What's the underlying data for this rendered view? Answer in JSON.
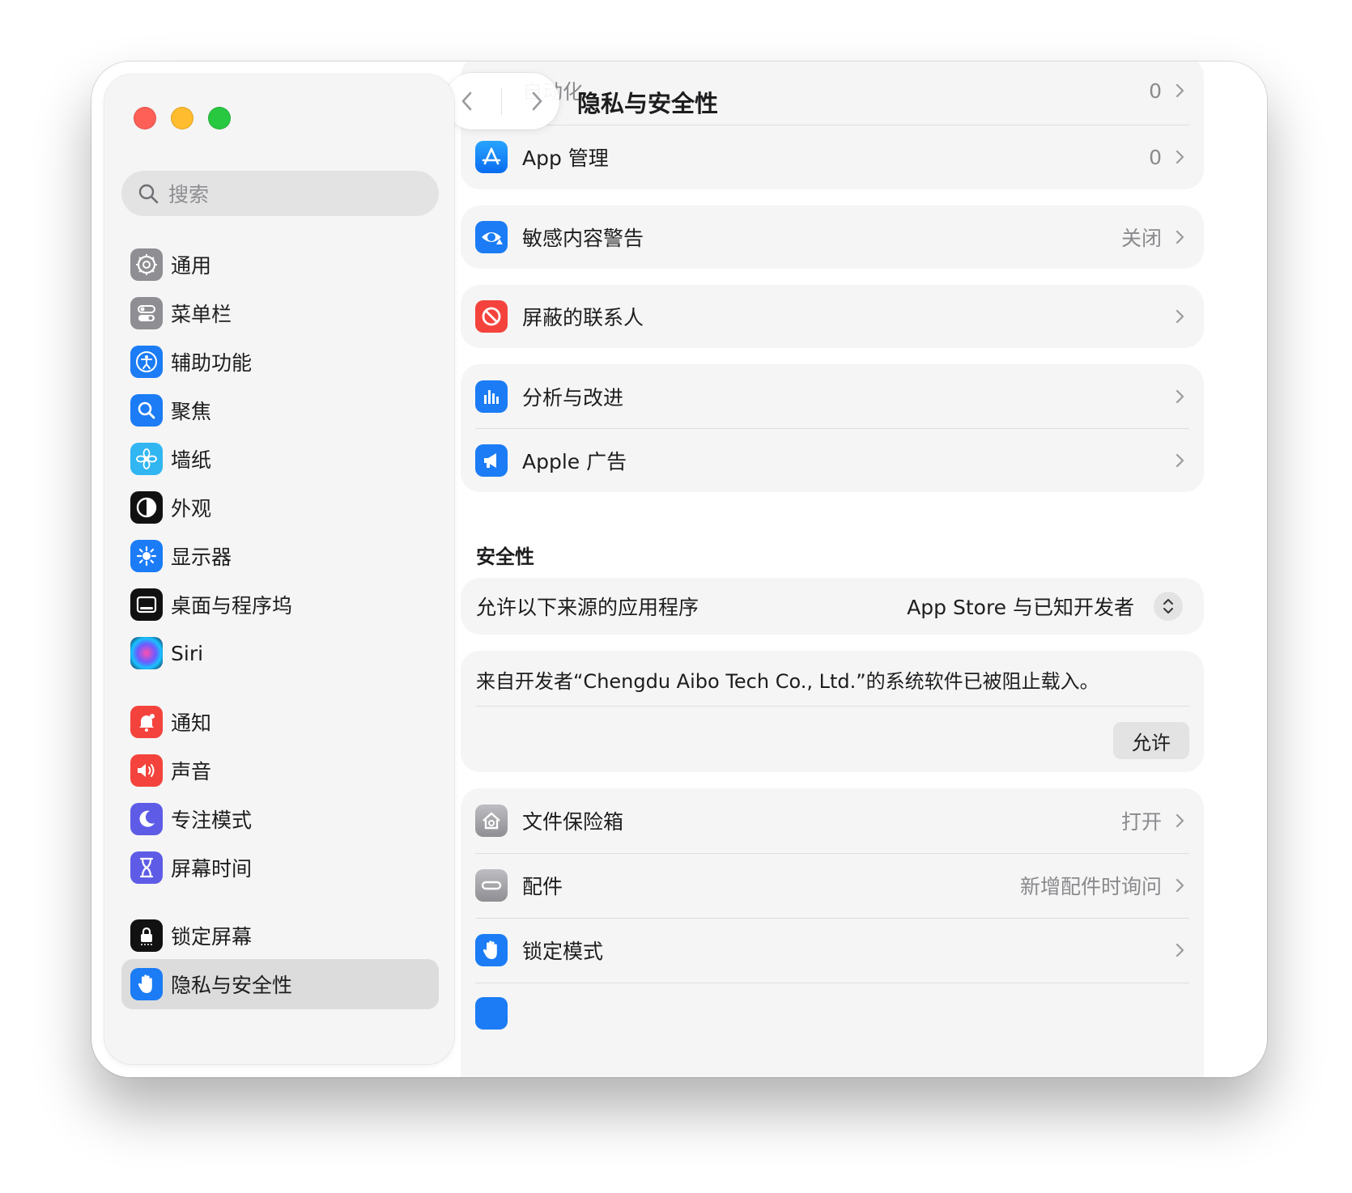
{
  "window": {
    "title": "隐私与安全性",
    "search_placeholder": "搜索"
  },
  "sidebar": {
    "items": [
      {
        "label": "通用",
        "icon": "gear-icon",
        "color": "#8e8e93"
      },
      {
        "label": "菜单栏",
        "icon": "toggles-icon",
        "color": "#8e8e93"
      },
      {
        "label": "辅助功能",
        "icon": "accessibility-icon",
        "color": "#1b7cf5"
      },
      {
        "label": "聚焦",
        "icon": "magnifier-icon",
        "color": "#1b7cf5"
      },
      {
        "label": "墙纸",
        "icon": "flower-icon",
        "color": "#31b6f2"
      },
      {
        "label": "外观",
        "icon": "appearance-icon",
        "color": "#111111"
      },
      {
        "label": "显示器",
        "icon": "sun-icon",
        "color": "#1b7cf5"
      },
      {
        "label": "桌面与程序坞",
        "icon": "dock-icon",
        "color": "#111111"
      },
      {
        "label": "Siri",
        "icon": "siri-icon",
        "color": "#2b2b6e"
      },
      {
        "label": "通知",
        "icon": "bell-icon",
        "color": "#f4433c"
      },
      {
        "label": "声音",
        "icon": "speaker-icon",
        "color": "#f4433c"
      },
      {
        "label": "专注模式",
        "icon": "moon-icon",
        "color": "#5e5ce6"
      },
      {
        "label": "屏幕时间",
        "icon": "hourglass-icon",
        "color": "#5e5ce6"
      },
      {
        "label": "锁定屏幕",
        "icon": "lock-icon",
        "color": "#111111"
      },
      {
        "label": "隐私与安全性",
        "icon": "hand-icon",
        "color": "#1b7cf5",
        "selected": true
      }
    ]
  },
  "main": {
    "rows_top": [
      {
        "label": "自动化",
        "value": "0"
      },
      {
        "label": "App 管理",
        "value": "0"
      }
    ],
    "sensitive": {
      "label": "敏感内容警告",
      "value": "关闭"
    },
    "blocked": {
      "label": "屏蔽的联系人"
    },
    "analytics": [
      {
        "label": "分析与改进"
      },
      {
        "label": "Apple 广告"
      }
    ],
    "security_title": "安全性",
    "allow_apps": {
      "label": "允许以下来源的应用程序",
      "value": "App Store 与已知开发者"
    },
    "blocked_software": {
      "message": "来自开发者“Chengdu Aibo Tech Co., Ltd.”的系统软件已被阻止载入。",
      "button": "允许"
    },
    "rows_bottom": [
      {
        "label": "文件保险箱",
        "value": "打开"
      },
      {
        "label": "配件",
        "value": "新增配件时询问"
      },
      {
        "label": "锁定模式",
        "value": ""
      }
    ]
  },
  "colors": {
    "accent": "#1b7cf5",
    "red": "#f4433c"
  }
}
